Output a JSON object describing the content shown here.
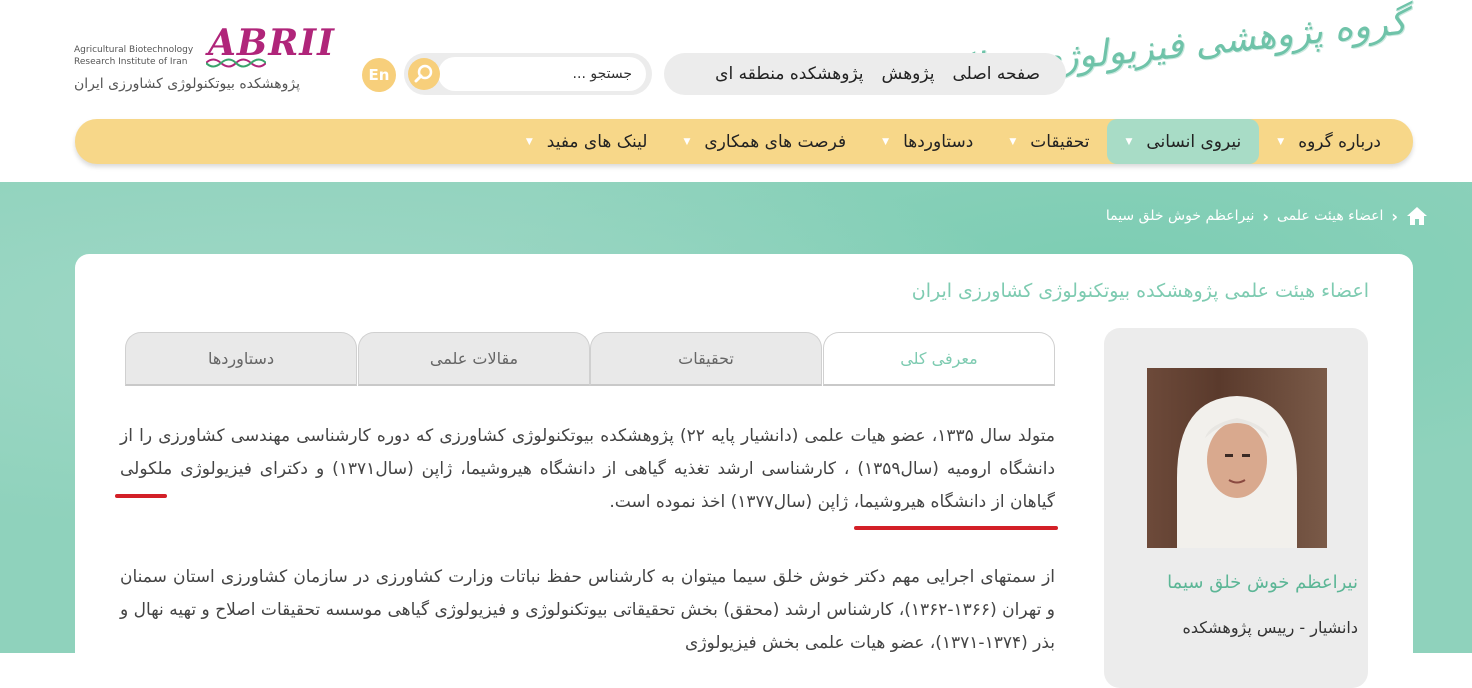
{
  "header": {
    "site_title": "گروه پژوهشی فیزیولوژی مولکولی",
    "top_nav": [
      "صفحه اصلی",
      "پژوهش",
      "پژوهشکده منطقه ای"
    ],
    "search": {
      "placeholder": "جستجو ..."
    },
    "lang_button": "En",
    "logo": {
      "word": "ABRII",
      "en_line1": "Agricultural Biotechnology",
      "en_line2": "Research Institute of Iran",
      "fa": "پژوهشکده بیوتکنولوژی کشاورزی ایران"
    }
  },
  "main_nav": {
    "items": [
      {
        "label": "درباره گروه"
      },
      {
        "label": "نیروی انسانی"
      },
      {
        "label": "تحقیقات"
      },
      {
        "label": "دستاوردها"
      },
      {
        "label": "فرصت های همکاری"
      },
      {
        "label": "لینک های مفید"
      }
    ],
    "active_index": 1
  },
  "breadcrumb": {
    "items": [
      "اعضاء هیئت علمی",
      "نیراعظم خوش خلق سیما"
    ]
  },
  "content": {
    "title": "اعضاء هیئت علمی پژوهشکده بیوتکنولوژی کشاورزی ایران",
    "tabs": [
      "معرفی کلی",
      "تحقیقات",
      "مقالات علمی",
      "دستاوردها"
    ],
    "active_tab": 0,
    "paragraph1": "متولد سال ۱۳۳۵، عضو هیات علمی (دانشیار پایه ۲۲) پژوهشکده بیوتکنولوژی کشاورزی که دوره کارشناسی مهندسی کشاورزی را از دانشگاه ارومیه (سال۱۳۵۹) ، کارشناسی ارشد تغذیه گیاهی از دانشگاه هیروشیما، ژاپن (سال۱۳۷۱) و دکترای فیزیولوژی ملکولی گیاهان از دانشگاه هیروشیما، ژاپن (سال۱۳۷۷) اخذ نموده است.",
    "paragraph2": "از سمتهای اجرایی مهم دکتر خوش خلق سیما میتوان به کارشناس حفظ نباتات وزارت کشاورزی در سازمان کشاورزی استان سمنان و تهران (۱۳۶۶-۱۳۶۲)، کارشناس ارشد (محقق) بخش تحقیقاتی بیوتکنولوژی و فیزیولوژی گیاهی موسسه تحقیقات اصلاح و تهیه نهال و بذر (۱۳۷۴-۱۳۷۱)، عضو هیات علمی بخش فیزیولوژی"
  },
  "profile": {
    "name": "نیراعظم خوش خلق سیما",
    "role": "دانشیار - رییس پژوهشکده"
  },
  "colors": {
    "accent_green": "#7ecbb1",
    "nav_yellow": "#f7d789",
    "active_nav": "#a8dcc6",
    "highlight_red": "#d32027"
  }
}
